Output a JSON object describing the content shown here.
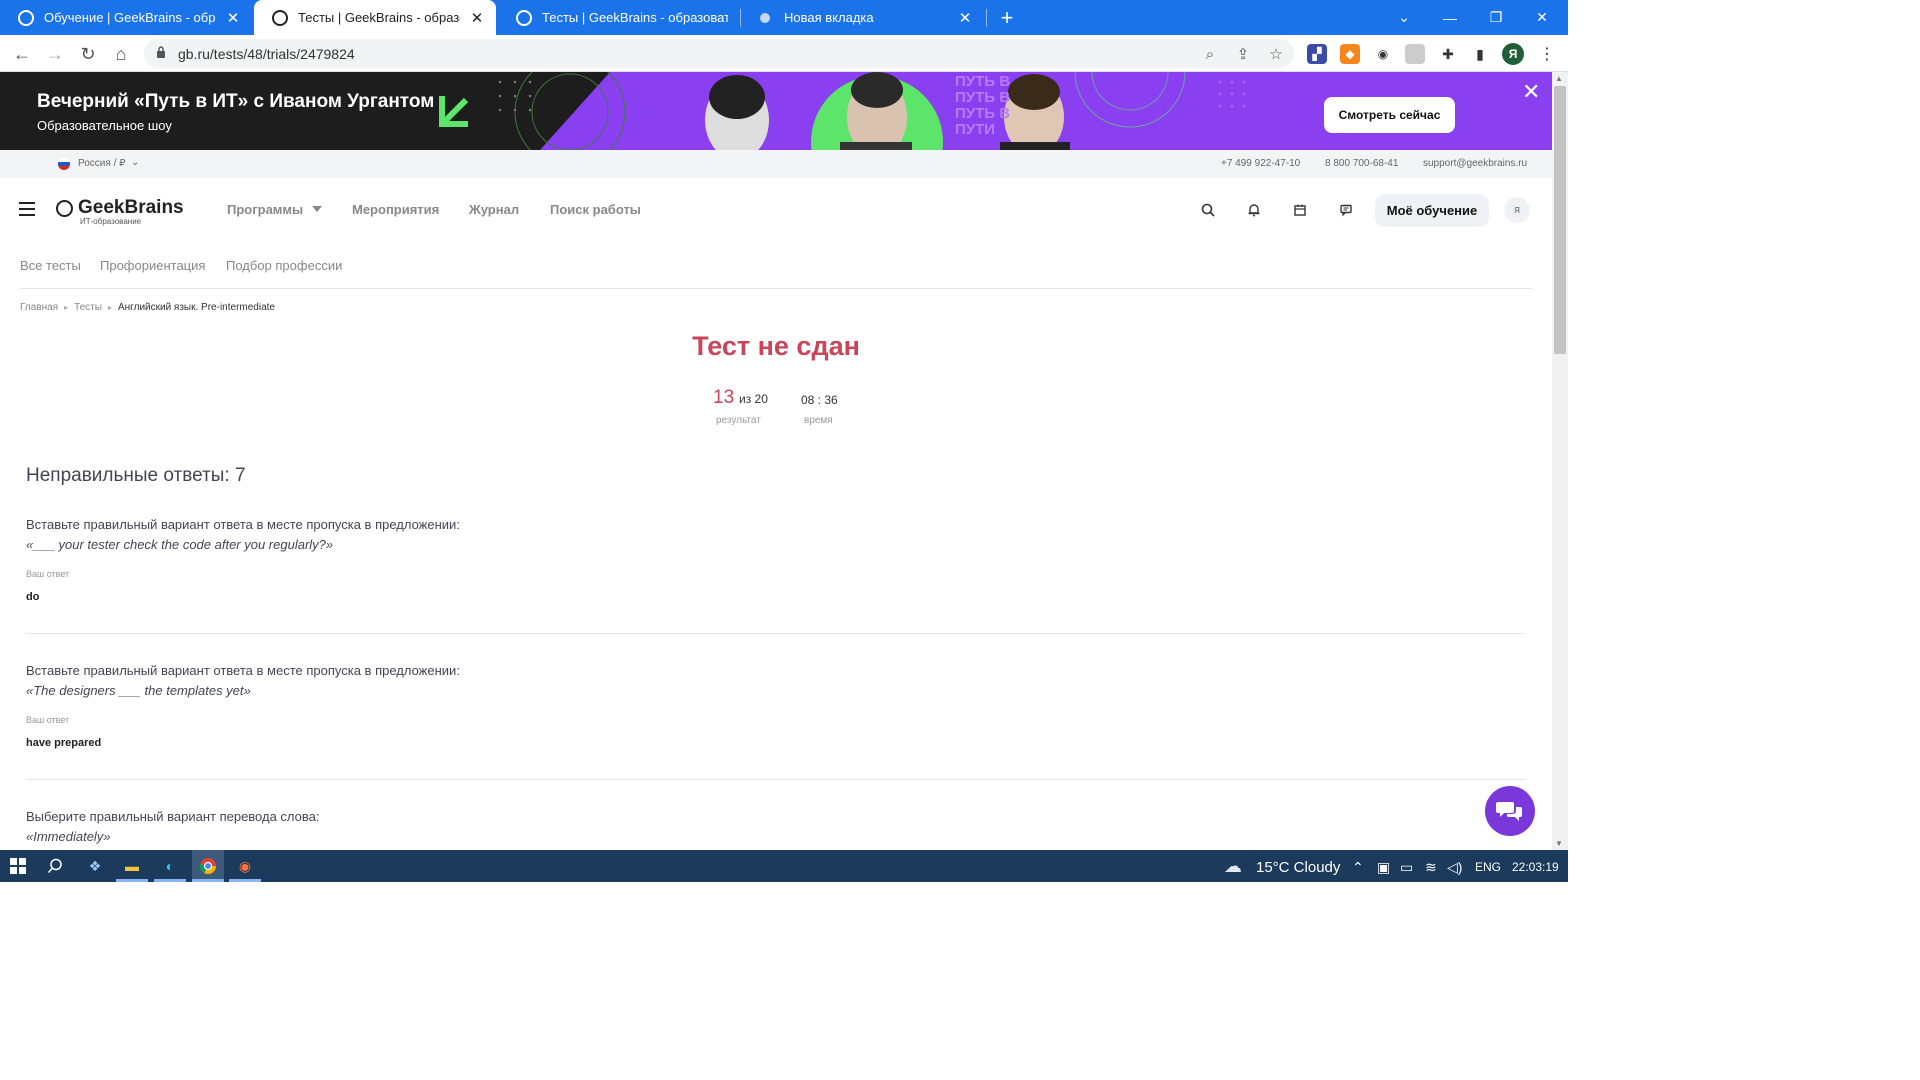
{
  "browser": {
    "tabs": [
      {
        "title": "Обучение | GeekBrains - образо",
        "active": false
      },
      {
        "title": "Тесты | GeekBrains - образовате",
        "active": true
      },
      {
        "title": "Тесты | GeekBrains - образовате",
        "active": false
      },
      {
        "title": "Новая вкладка",
        "active": false
      }
    ],
    "new_tab": "+",
    "url": "gb.ru/tests/48/trials/2479824",
    "profile_initial": "Я"
  },
  "banner": {
    "title": "Вечерний «Путь в ИТ» с Иваном Ургантом",
    "subtitle": "Образовательное шоу",
    "cta": "Смотреть сейчас",
    "overlay_text": [
      "ПУТЬ В",
      "ПУТЬ В",
      "ПУТЬ В",
      "ПУТИ"
    ]
  },
  "infobar": {
    "region": "Россия / ₽",
    "phone1": "+7 499 922-47-10",
    "phone2": "8 800 700-68-41",
    "email": "support@geekbrains.ru"
  },
  "header": {
    "logo": "GeekBrains",
    "logo_sub": "ИТ-образование",
    "nav": [
      "Программы",
      "Мероприятия",
      "Журнал",
      "Поиск работы"
    ],
    "my_learning": "Моё обучение",
    "avatar": "Я"
  },
  "subnav": [
    "Все тесты",
    "Профориентация",
    "Подбор профессии"
  ],
  "breadcrumb": [
    "Главная",
    "Тесты",
    "Английский язык. Pre-intermediate"
  ],
  "result": {
    "title": "Тест не сдан",
    "score": "13",
    "score_of": "из 20",
    "score_label": "результат",
    "time": "08 : 36",
    "time_label": "время"
  },
  "wrong": {
    "heading": "Неправильные ответы: 7",
    "answer_label": "Ваш ответ",
    "questions": [
      {
        "text": "Вставьте правильный вариант ответа в месте пропуска в предложении:",
        "quote": "«___ your tester check the code after you regularly?»",
        "answer": "do"
      },
      {
        "text": "Вставьте правильный вариант ответа в месте пропуска в предложении:",
        "quote": "«The designers ___ the templates yet»",
        "answer": "have prepared"
      },
      {
        "text": "Выберите правильный вариант перевода слова:",
        "quote": "«Immediately»",
        "answer": ""
      }
    ]
  },
  "taskbar": {
    "weather": "15°C  Cloudy",
    "lang": "ENG",
    "time": "22:03:19"
  },
  "colors": {
    "chrome_blue": "#1a73e8",
    "fail_red": "#c8455a",
    "banner_purple": "#8a3ff0",
    "banner_green": "#5ce56a",
    "chat_purple": "#7a37d9",
    "taskbar": "#1b3a5c"
  }
}
